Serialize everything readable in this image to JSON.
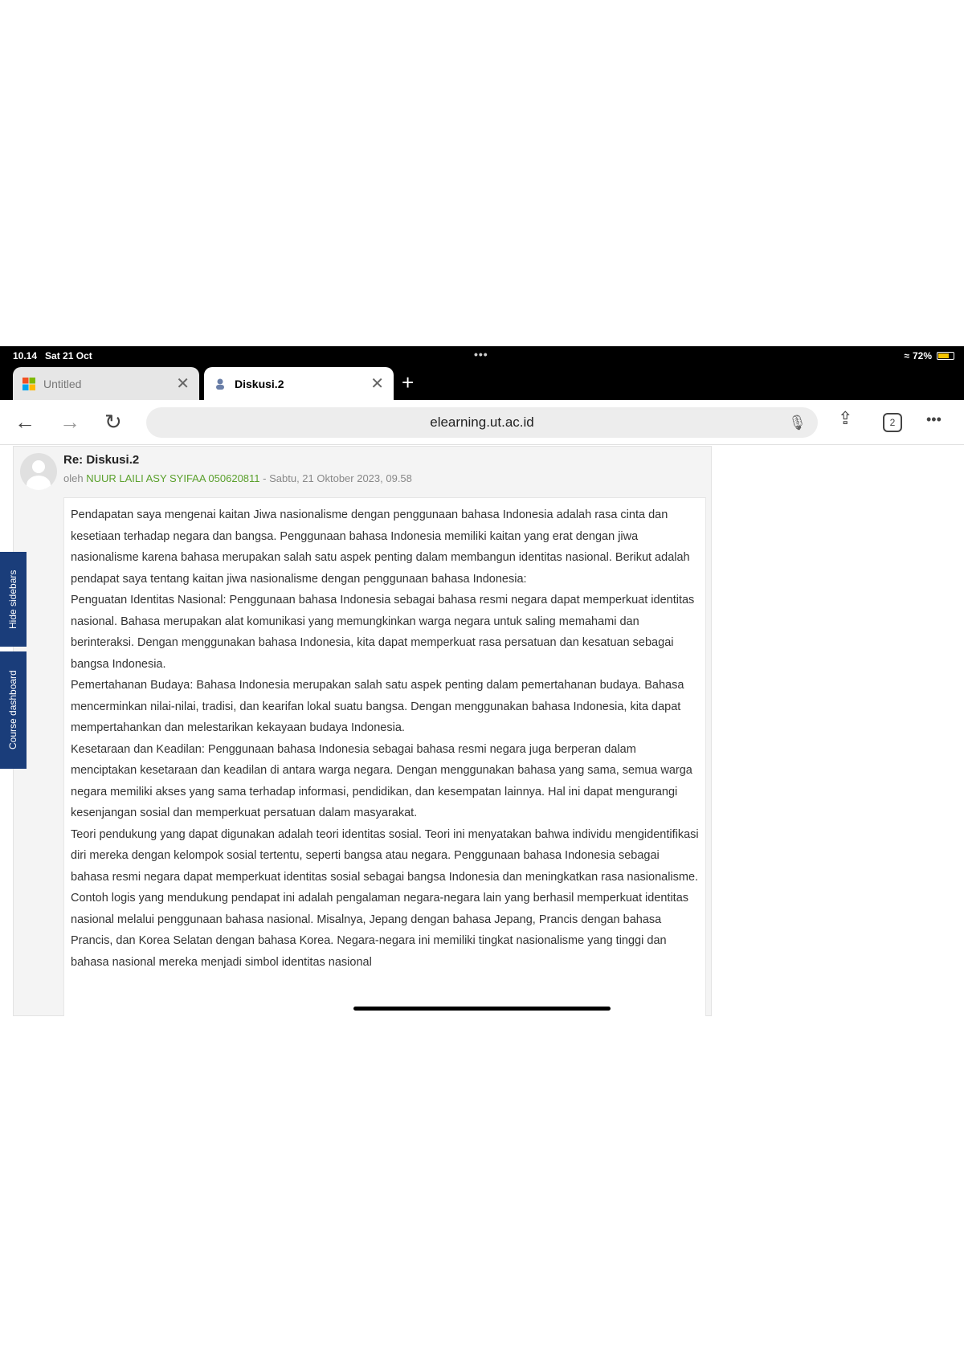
{
  "status": {
    "time": "10.14",
    "date": "Sat 21 Oct",
    "battery": "72%",
    "battery_level": 0.72
  },
  "tabs": [
    {
      "label": "Untitled"
    },
    {
      "label": "Diskusi.2"
    }
  ],
  "toolbar": {
    "url": "elearning.ut.ac.id",
    "tab_count": "2"
  },
  "sidebar": {
    "hide_label": "Hide sidebars",
    "course_label": "Course dashboard"
  },
  "post": {
    "title": "Re: Diskusi.2",
    "by_prefix": "oleh",
    "author": "NUUR LAILI ASY SYIFAA 050620811",
    "date": "- Sabtu, 21 Oktober 2023, 09.58",
    "paragraphs": [
      "Pendapatan saya mengenai kaitan Jiwa nasionalisme dengan penggunaan bahasa Indonesia adalah rasa cinta dan kesetiaan terhadap negara dan bangsa. Penggunaan bahasa Indonesia memiliki kaitan yang erat dengan jiwa nasionalisme karena bahasa merupakan salah satu aspek penting dalam membangun identitas nasional. Berikut adalah pendapat saya tentang kaitan jiwa nasionalisme dengan penggunaan bahasa Indonesia:",
      "Penguatan Identitas Nasional: Penggunaan bahasa Indonesia sebagai bahasa resmi negara dapat memperkuat identitas nasional. Bahasa merupakan alat komunikasi yang memungkinkan warga negara untuk saling memahami dan berinteraksi. Dengan menggunakan bahasa Indonesia, kita dapat memperkuat rasa persatuan dan kesatuan sebagai bangsa Indonesia.",
      "Pemertahanan Budaya: Bahasa Indonesia merupakan salah satu aspek penting dalam pemertahanan budaya. Bahasa mencerminkan nilai-nilai, tradisi, dan kearifan lokal suatu bangsa. Dengan menggunakan bahasa Indonesia, kita dapat mempertahankan dan melestarikan kekayaan budaya Indonesia.",
      "Kesetaraan dan Keadilan: Penggunaan bahasa Indonesia sebagai bahasa resmi negara juga berperan dalam menciptakan kesetaraan dan keadilan di antara warga negara. Dengan menggunakan bahasa yang sama, semua warga negara memiliki akses yang sama terhadap informasi, pendidikan, dan kesempatan lainnya. Hal ini dapat mengurangi kesenjangan sosial dan memperkuat persatuan dalam masyarakat.",
      "Teori pendukung yang dapat digunakan adalah teori identitas sosial. Teori ini menyatakan bahwa individu mengidentifikasi diri mereka dengan kelompok sosial tertentu, seperti bangsa atau negara. Penggunaan bahasa Indonesia sebagai bahasa resmi negara dapat memperkuat identitas sosial sebagai bangsa Indonesia dan meningkatkan rasa nasionalisme.",
      "Contoh logis yang mendukung pendapat ini adalah pengalaman negara-negara lain yang berhasil memperkuat identitas nasional melalui penggunaan bahasa nasional. Misalnya, Jepang dengan bahasa Jepang, Prancis dengan bahasa Prancis, dan Korea Selatan dengan bahasa Korea. Negara-negara ini memiliki tingkat nasionalisme yang tinggi dan bahasa nasional mereka menjadi simbol identitas nasional"
    ]
  }
}
